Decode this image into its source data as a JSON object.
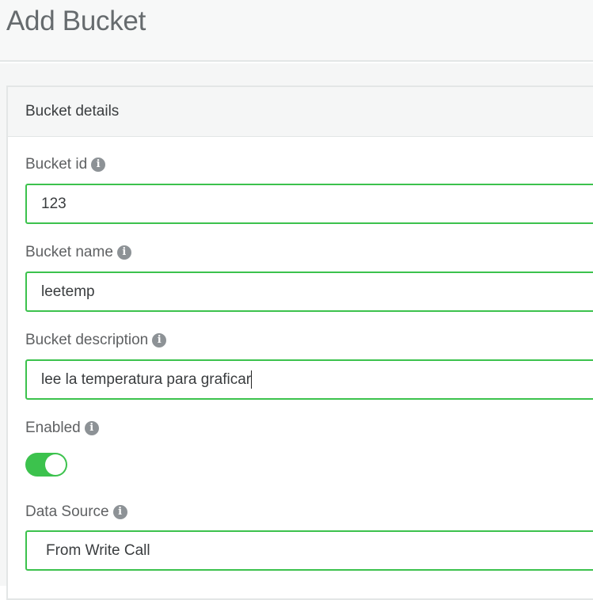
{
  "header": {
    "title": "Add Bucket"
  },
  "panel": {
    "title": "Bucket details"
  },
  "fields": {
    "bucket_id": {
      "label": "Bucket id",
      "value": "123"
    },
    "bucket_name": {
      "label": "Bucket name",
      "value": "leetemp"
    },
    "bucket_description": {
      "label": "Bucket description",
      "value": "lee la temperatura para graficar"
    },
    "enabled": {
      "label": "Enabled",
      "on": true
    },
    "data_source": {
      "label": "Data Source",
      "selected": "From Write Call"
    }
  },
  "icons": {
    "info": "info-icon"
  },
  "colors": {
    "accent_green": "#3cc24d",
    "info_icon": "#8d9296",
    "header_bg": "#f7f8f8"
  }
}
